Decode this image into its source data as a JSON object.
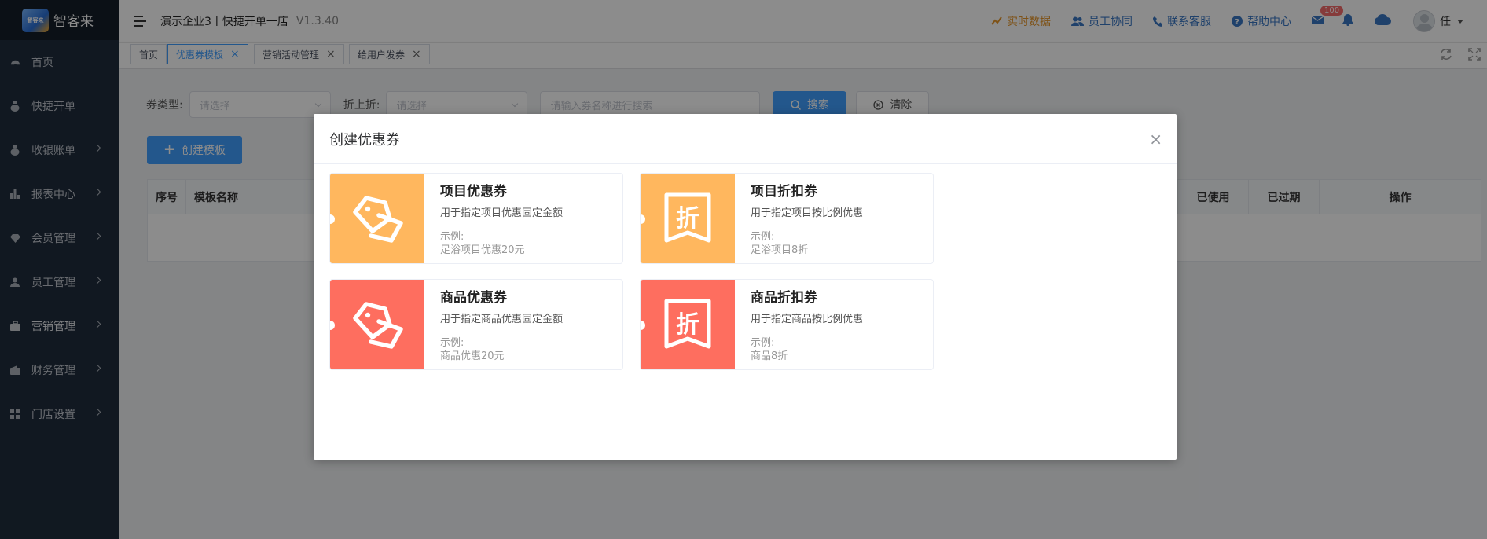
{
  "app": {
    "logo_text": "智客来",
    "logo_mark": "智客来",
    "company": "演示企业3丨快捷开单一店",
    "version": "V1.3.40"
  },
  "sidebar": {
    "items": [
      {
        "label": "首页",
        "icon": "dashboard-icon",
        "arrow": false
      },
      {
        "label": "快捷开单",
        "icon": "moneybag-icon",
        "arrow": false
      },
      {
        "label": "收银账单",
        "icon": "moneybag-icon",
        "arrow": true
      },
      {
        "label": "报表中心",
        "icon": "bar-chart-icon",
        "arrow": true
      },
      {
        "label": "会员管理",
        "icon": "diamond-icon",
        "arrow": true
      },
      {
        "label": "员工管理",
        "icon": "person-icon",
        "arrow": true
      },
      {
        "label": "营销管理",
        "icon": "briefcase-icon",
        "arrow": true
      },
      {
        "label": "财务管理",
        "icon": "wallet-icon",
        "arrow": true
      },
      {
        "label": "门店设置",
        "icon": "grid-icon",
        "arrow": true
      }
    ]
  },
  "header": {
    "realtime": "实时数据",
    "staff": "员工协同",
    "service": "联系客服",
    "help": "帮助中心",
    "mail_badge": "100",
    "user_name": "任"
  },
  "tabs": [
    {
      "label": "首页",
      "closable": false,
      "active": false
    },
    {
      "label": "优惠券模板",
      "closable": true,
      "active": true
    },
    {
      "label": "营销活动管理",
      "closable": true,
      "active": false
    },
    {
      "label": "给用户发券",
      "closable": true,
      "active": false
    }
  ],
  "filter": {
    "type_label": "券类型:",
    "type_placeholder": "请选择",
    "discount_label": "折上折:",
    "discount_placeholder": "请选择",
    "name_placeholder": "请输入券名称进行搜索",
    "search": "搜索",
    "clear": "清除"
  },
  "create_button": "创建模板",
  "table": {
    "headers": [
      "序号",
      "模板名称",
      "已使用",
      "已过期",
      "操作"
    ]
  },
  "dialog": {
    "title": "创建优惠券",
    "cards": [
      {
        "title": "项目优惠券",
        "desc": "用于指定项目优惠固定金额",
        "example_label": "示例:",
        "example": "足浴项目优惠20元",
        "icon": "tag-icon",
        "color": "#ffb75e"
      },
      {
        "title": "项目折扣券",
        "desc": "用于指定项目按比例优惠",
        "example_label": "示例:",
        "example": "足浴项目8折",
        "icon": "discount-icon",
        "icon_char": "折",
        "color": "#ffb75e"
      },
      {
        "title": "商品优惠券",
        "desc": "用于指定商品优惠固定金额",
        "example_label": "示例:",
        "example": "商品优惠20元",
        "icon": "tag-icon",
        "color": "#fe6e5f"
      },
      {
        "title": "商品折扣券",
        "desc": "用于指定商品按比例优惠",
        "example_label": "示例:",
        "example": "商品8折",
        "icon": "discount-icon",
        "icon_char": "折",
        "color": "#fe6e5f"
      }
    ]
  },
  "colors": {
    "sidebar_bg": "#1f2d3d",
    "primary": "#409eff",
    "coupon_orange": "#ffb75e",
    "coupon_red": "#fe6e5f"
  }
}
